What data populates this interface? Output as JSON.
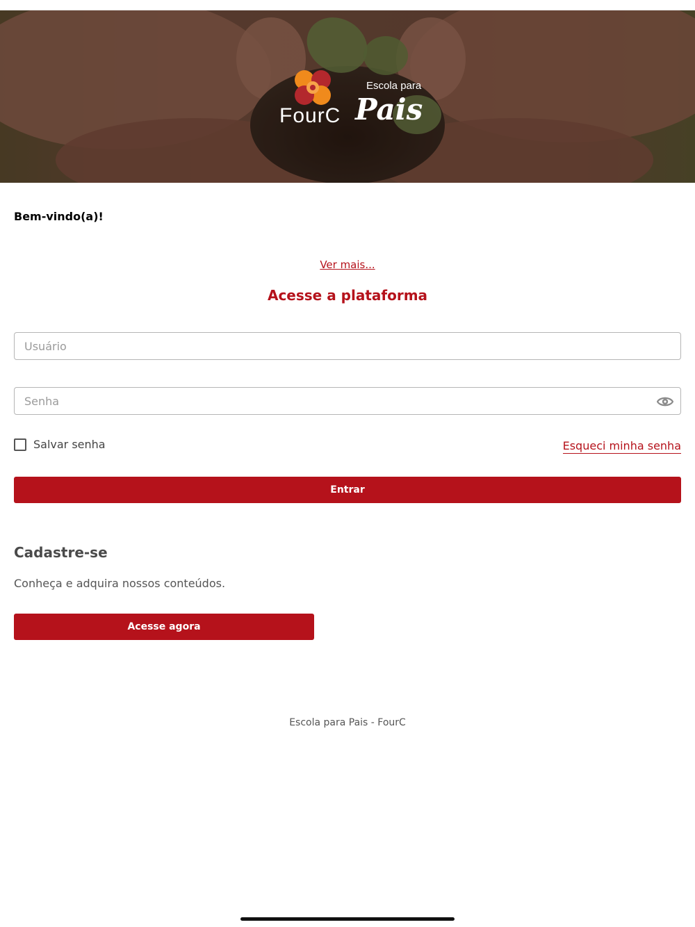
{
  "header": {
    "logo_brand": "FourC",
    "logo_subtitle": "Escola para",
    "logo_title": "Pais"
  },
  "welcome": "Bem-vindo(a)!",
  "see_more": "Ver mais...",
  "login": {
    "title": "Acesse a plataforma",
    "username_placeholder": "Usuário",
    "username_value": "",
    "password_placeholder": "Senha",
    "password_value": "",
    "remember_label": "Salvar senha",
    "remember_checked": false,
    "forgot_label": "Esqueci minha senha",
    "submit_label": "Entrar"
  },
  "register": {
    "title": "Cadastre-se",
    "text": "Conheça e adquira nossos conteúdos.",
    "button_label": "Acesse agora"
  },
  "footer": "Escola para Pais - FourC",
  "colors": {
    "accent": "#b5121b",
    "logo_orange": "#f08a1c",
    "logo_red": "#b3282d"
  }
}
